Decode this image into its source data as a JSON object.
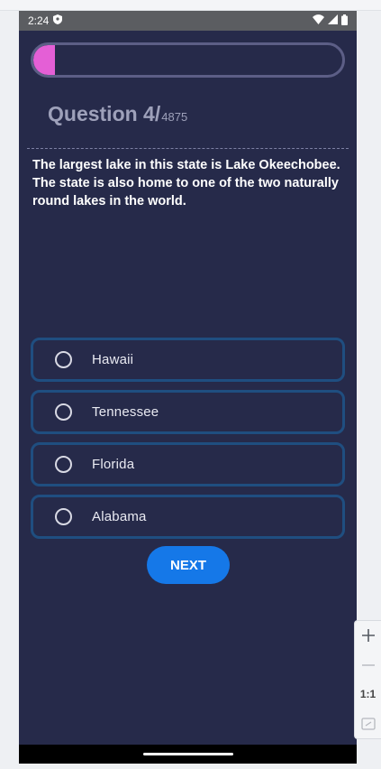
{
  "status_bar": {
    "time": "2:24",
    "icons": [
      "shield-icon",
      "wifi-icon",
      "cell-signal-icon",
      "battery-icon"
    ]
  },
  "quiz": {
    "progress_fraction": 0.07,
    "question_label": "Question 4",
    "separator": "/",
    "total": "4875",
    "question_text": "The largest lake in this state is Lake Okeechobee. The state is also home to one of the two naturally round lakes in the world.",
    "options": [
      {
        "label": "Hawaii"
      },
      {
        "label": "Tennessee"
      },
      {
        "label": "Florida"
      },
      {
        "label": "Alabama"
      }
    ],
    "next_label": "NEXT"
  },
  "emulator_toolbar": {
    "zoom_label": "1:1",
    "tools": [
      "plus-icon",
      "minus-icon",
      "zoom-reset",
      "screenshot-frame-icon"
    ]
  },
  "colors": {
    "background": "#262a4a",
    "progress_fill": "#e45fd6",
    "option_border": "#1f4e80",
    "button": "#1578e8"
  }
}
